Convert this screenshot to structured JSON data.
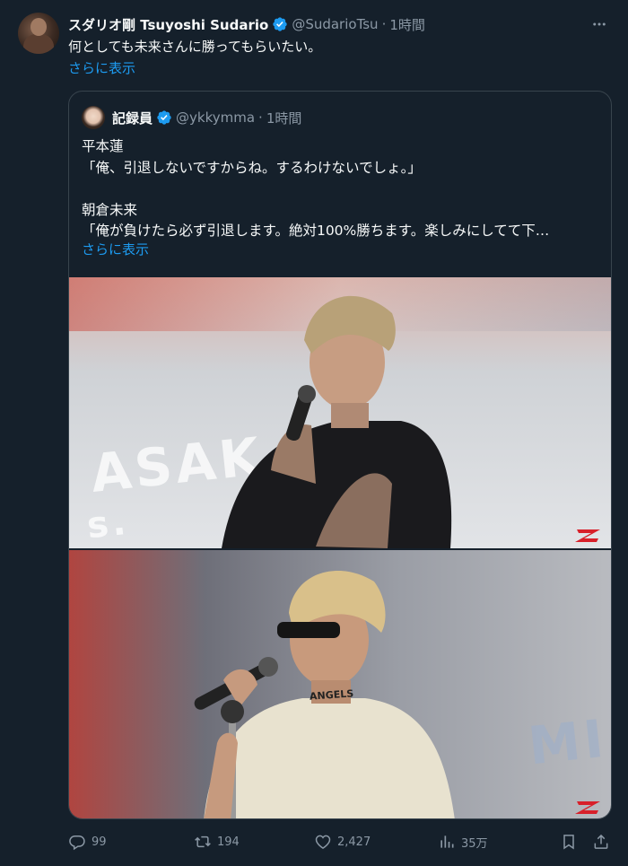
{
  "tweet": {
    "author_name": "スダリオ剛 Tsuyoshi Sudario",
    "handle": "@SudarioTsu",
    "separator": "·",
    "time": "1時間",
    "text": "何としても未来さんに勝ってもらいたい。",
    "show_more": "さらに表示"
  },
  "quote": {
    "author_name": "記録員",
    "handle": "@ykkymma",
    "separator": "·",
    "time": "1時間",
    "lines": [
      "平本蓮",
      "「俺、引退しないですからね。するわけないでしょ。」",
      "",
      "朝倉未来",
      "「俺が負けたら必ず引退します。絶対100%勝ちます。楽しみにしてて下…"
    ],
    "show_more": "さらに表示"
  },
  "photos": {
    "photo1_bg_text": "ASAK",
    "photo1_bg_text2": "s.",
    "photo2_bg_text": "MI",
    "shirt_text": "ANGELS"
  },
  "actions": {
    "replies": "99",
    "reposts": "194",
    "likes": "2,427",
    "views": "35万"
  },
  "colors": {
    "background": "#15202b",
    "accent": "#1d9bf0",
    "secondary_text": "#8b98a5",
    "border": "#38444d"
  },
  "icons": [
    "verified-badge-icon",
    "more-icon",
    "reply-icon",
    "repost-icon",
    "like-icon",
    "views-icon",
    "bookmark-icon",
    "share-icon"
  ]
}
